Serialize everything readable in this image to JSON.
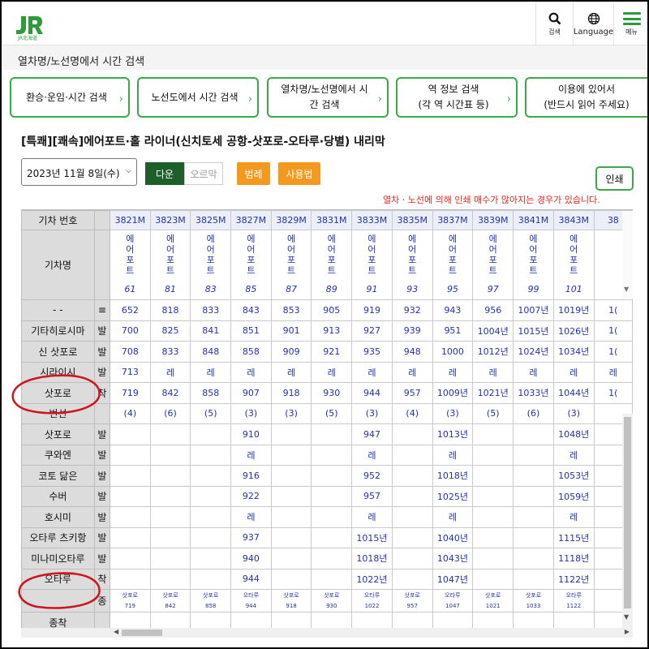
{
  "header": {
    "logo_text": "JR北海道",
    "search_label": "검색",
    "language_label": "Language",
    "menu_label": "메뉴"
  },
  "breadcrumb": "열차명/노선명에서 시간 검색",
  "nav": [
    {
      "line1": "환승·운임·시간 검색",
      "line2": ""
    },
    {
      "line1": "노선도에서 시간 검색",
      "line2": ""
    },
    {
      "line1": "열차명/노선명에서 시",
      "line2": "간 검색"
    },
    {
      "line1": "역 정보 검색",
      "line2": "(각 역 시간표 등)"
    },
    {
      "line1": "이용에 있어서",
      "line2": "(반드시 읽어 주세요)"
    }
  ],
  "page_title": "[특쾌][쾌속]에어포트·홀 라이너(신치토세 공항-삿포로-오타루·당별) 내리막",
  "controls": {
    "date": "2023년 11월 8일(수)",
    "down": "다운",
    "up": "오르막",
    "legend": "범례",
    "usage": "사용법",
    "print": "인쇄"
  },
  "notice": "열차 · 노선에 의해 인쇄 매수가 많아지는 경우가 있습니다.",
  "table": {
    "train_no_label": "기차 번호",
    "train_name_label": "기차명",
    "train_no": [
      "3821M",
      "3823M",
      "3825M",
      "3827M",
      "3829M",
      "3831M",
      "3833M",
      "3835M",
      "3837M",
      "3839M",
      "3841M",
      "3843M",
      "38"
    ],
    "train_name_chars": [
      "에",
      "어",
      "포",
      "트"
    ],
    "train_name_nums": [
      "61",
      "81",
      "83",
      "85",
      "87",
      "89",
      "91",
      "93",
      "95",
      "97",
      "99",
      "101",
      ""
    ],
    "rows": [
      {
        "station": "- -",
        "ad": "≡",
        "cells": [
          "652",
          "818",
          "833",
          "843",
          "853",
          "905",
          "919",
          "932",
          "943",
          "956",
          "1007년",
          "1019년",
          "1("
        ]
      },
      {
        "station": "기타히로시마",
        "ad": "발",
        "cells": [
          "700",
          "825",
          "841",
          "851",
          "901",
          "913",
          "927",
          "939",
          "951",
          "1004년",
          "1015년",
          "1026년",
          "1("
        ]
      },
      {
        "station": "신 삿포로",
        "ad": "발",
        "cells": [
          "708",
          "833",
          "848",
          "858",
          "909",
          "921",
          "935",
          "948",
          "1000",
          "1012년",
          "1024년",
          "1034년",
          "1("
        ]
      },
      {
        "station": "시라이시",
        "ad": "발",
        "cells": [
          "713",
          "레",
          "레",
          "레",
          "레",
          "레",
          "레",
          "레",
          "레",
          "레",
          "레",
          "레",
          "레"
        ]
      },
      {
        "station": "삿포로",
        "ad": "착",
        "cells": [
          "719",
          "842",
          "858",
          "907",
          "918",
          "930",
          "944",
          "957",
          "1009년",
          "1021년",
          "1033년",
          "1044년",
          "1("
        ]
      },
      {
        "station": "번선",
        "ad": "",
        "cells": [
          "(4)",
          "(6)",
          "(5)",
          "(3)",
          "(3)",
          "(5)",
          "(3)",
          "(4)",
          "(3)",
          "(5)",
          "(6)",
          "(3)",
          ""
        ]
      },
      {
        "station": "삿포로",
        "ad": "발",
        "cells": [
          "",
          "",
          "",
          "910",
          "",
          "",
          "947",
          "",
          "1013년",
          "",
          "",
          "1048년",
          ""
        ]
      },
      {
        "station": "쿠와엔",
        "ad": "발",
        "cells": [
          "",
          "",
          "",
          "레",
          "",
          "",
          "레",
          "",
          "레",
          "",
          "",
          "레",
          ""
        ]
      },
      {
        "station": "코토 닮은",
        "ad": "발",
        "cells": [
          "",
          "",
          "",
          "916",
          "",
          "",
          "952",
          "",
          "1018년",
          "",
          "",
          "1053년",
          ""
        ]
      },
      {
        "station": "수버",
        "ad": "발",
        "cells": [
          "",
          "",
          "",
          "922",
          "",
          "",
          "957",
          "",
          "1025년",
          "",
          "",
          "1059년",
          ""
        ]
      },
      {
        "station": "호시미",
        "ad": "발",
        "cells": [
          "",
          "",
          "",
          "레",
          "",
          "",
          "레",
          "",
          "레",
          "",
          "",
          "레",
          ""
        ]
      },
      {
        "station": "오타루 츠키항",
        "ad": "발",
        "cells": [
          "",
          "",
          "",
          "937",
          "",
          "",
          "1015년",
          "",
          "1040년",
          "",
          "",
          "1115년",
          ""
        ]
      },
      {
        "station": "미나미오타루",
        "ad": "발",
        "cells": [
          "",
          "",
          "",
          "940",
          "",
          "",
          "1018년",
          "",
          "1043년",
          "",
          "",
          "1118년",
          ""
        ]
      },
      {
        "station": "오타루",
        "ad": "착",
        "cells": [
          "",
          "",
          "",
          "944",
          "",
          "",
          "1022년",
          "",
          "1047년",
          "",
          "",
          "1122년",
          ""
        ]
      }
    ],
    "dest_label": "",
    "dest_ad": "종",
    "dest_top": [
      "삿포로",
      "삿포로",
      "삿포로",
      "오타루",
      "삿포로",
      "삿포로",
      "오타루",
      "삿포로",
      "오타루",
      "삿포로",
      "삿포로",
      "오타루",
      ""
    ],
    "dest_bottom": [
      "719",
      "842",
      "858",
      "944",
      "918",
      "930",
      "1022",
      "957",
      "1047",
      "1021",
      "1033",
      "1122",
      ""
    ],
    "terminal_label": "종착"
  },
  "colors": {
    "brand_green": "#3aa94a",
    "dark_green": "#1e5e2a",
    "orange": "#f39a1e",
    "link_blue": "#2233aa",
    "notice_red": "#e2261c",
    "annotation_red": "#d0141e"
  }
}
